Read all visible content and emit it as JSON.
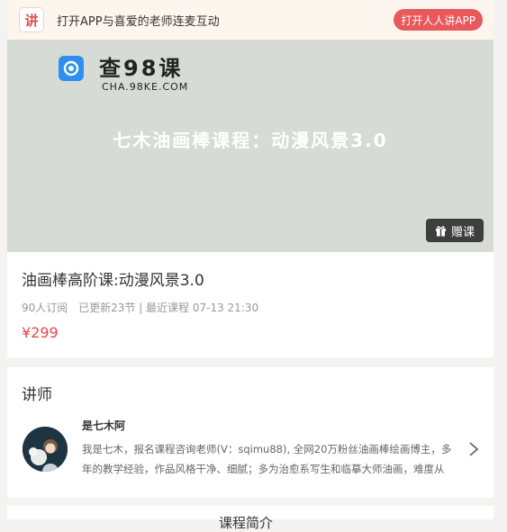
{
  "banner": {
    "logo_char": "讲",
    "text": "打开APP与喜爱的老师连麦互动",
    "button": "打开人人讲APP"
  },
  "cover": {
    "watermark_title": "查98课",
    "watermark_url": "CHA.98KE.COM",
    "title": "七木油画棒课程：动漫风景3.0",
    "gift_label": "赠课"
  },
  "course": {
    "title": "油画棒高阶课:动漫风景3.0",
    "subscribers": "90人订阅",
    "updates": "已更新23节 | 最近课程 07-13 21:30",
    "price": "¥299"
  },
  "teacher": {
    "section_title": "讲师",
    "name": "是七木阿",
    "description": "我是七木，报名课程咨询老师(V：sqimu88), 全网20万粉丝油画棒绘画博主，多年的教学经验，作品风格干净、细腻；多为治愈系写生和临摹大师油画，难度从"
  },
  "next_section": {
    "heading": "课程简介"
  },
  "colors": {
    "accent": "#e9585b",
    "price": "#e5484d",
    "cover_bg": "#d6dbd5"
  }
}
